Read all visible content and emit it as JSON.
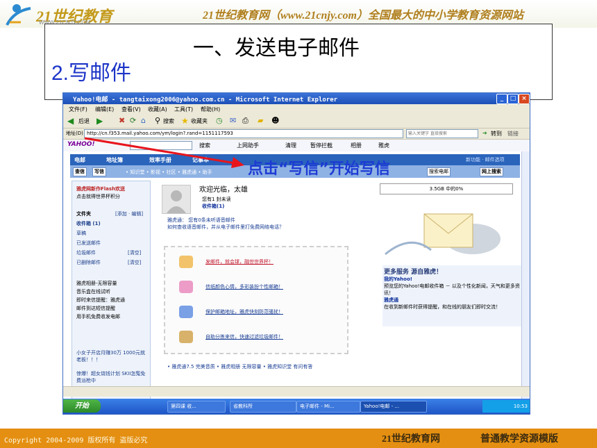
{
  "header": {
    "logo_text": "21世纪教育",
    "logo_sub": "WWW.21CNJY.COM",
    "slogan": "21世纪教育网（www.21cnjy.com）全国最大的中小学教育资源网站"
  },
  "slide": {
    "title": "一、发送电子邮件",
    "subtitle": "2.写邮件",
    "annotation": "点击“写信”开始写信"
  },
  "window": {
    "title": "Yahoo!电邮 - tangtaixong2006@yahoo.com.cn - Microsoft Internet Explorer",
    "menu": [
      "文件(F)",
      "编辑(E)",
      "查看(V)",
      "收藏(A)",
      "工具(T)",
      "帮助(H)"
    ],
    "toolbar": {
      "back": "后退",
      "search": "搜索",
      "favorites": "收藏夹"
    },
    "address_label": "地址(D)",
    "address": "http://cn.f353.mail.yahoo.com/ym/login?.rand=1151117593",
    "search_hint": "输入关键字 直接搜索",
    "go": "转到",
    "links": "链接",
    "yahoo_logo": "YAHOO!",
    "ytbar": [
      "搜索",
      "上网助手",
      "清理",
      "暂停拦截",
      "相册",
      "雅虎"
    ]
  },
  "mail": {
    "tabs": [
      "电邮",
      "地址簿",
      "效率手册",
      "记事本"
    ],
    "new_features": "新功能 · 邮件选项",
    "check": "查信",
    "compose": "写信",
    "subnav_links": "• 知识堂 • 影视 • 社区 • 雅虎通 • 助手",
    "search_button": "网上搜索",
    "search_scope": "搜索电邮",
    "sidebar": {
      "promo": "雅虎网新作Flash欢送",
      "promo2": "点击就得世界杯积分",
      "folders_label": "文件夹",
      "folders_action": "[添加 · 编辑]",
      "inbox": "收件箱 (1)",
      "drafts": "草稿",
      "sent": "已发送邮件",
      "spam": "垃圾邮件",
      "spam_action": "[清空]",
      "trash": "已删除邮件",
      "trash_action": "[清空]",
      "extras": [
        "雅虎相册-无限容量",
        "音乐盒在线试听",
        "即时来信提醒：雅虎通",
        "邮件到达短信提醒",
        "用手机免费收发电邮"
      ],
      "ad1": "小女子开店月赚30万 1000元就老板！！！",
      "ad2": "惊爆！超女烧钱计划 SKII怎冤免费派枪中"
    },
    "welcome": "欢迎光临，太雄",
    "unread": "您有1 封未读",
    "inbox_link": "收件箱(1)",
    "voice_title": "雅虎通：",
    "voice_text": "您有0条未听语音邮件",
    "voice_text2": "如何查收语音邮件，并从电子邮件里打免费网络电话？",
    "promo_links": [
      "发邮件，就会球，融世世界杯！",
      "信纸颜色心情，多彩装扮个性邮箱！",
      "保护邮箱地址，雅虎快刻防范骚扰！",
      "自助分拣来信，快速过滤垃圾邮件！"
    ],
    "footer_links": "• 雅虎通7.5 完美音质  • 雅虎相册 无限容量  • 雅虎知识堂 有问有答",
    "quota": "3.5GB 中的0%",
    "more_title": "更多服务 源自雅虎！",
    "my_yahoo": "我的Yahoo!",
    "my_yahoo_desc": "预览您的Yahoo!电邮收件箱 － 以及个性化新闻，天气和更多资讯！",
    "yahoo_tong": "雅虎通",
    "yahoo_tong_desc": "在收到新邮件时获得提醒，和在线的朋友们即时交流！"
  },
  "taskbar": {
    "start": "开始",
    "tasks": [
      "第四课   收...",
      "省教科所",
      "电子邮件 - Mi...",
      "Yahoo!电邮 - ..."
    ],
    "clock": "10:53"
  },
  "footer": {
    "copyright": "Copyright 2004-2009 版权所有 盗版必究",
    "brand": "21世纪教育网",
    "template": "普通教学资源模版"
  },
  "colors": {
    "accent": "#1c34c8",
    "footer": "#e48f11",
    "xp_blue": "#2a64bb"
  }
}
